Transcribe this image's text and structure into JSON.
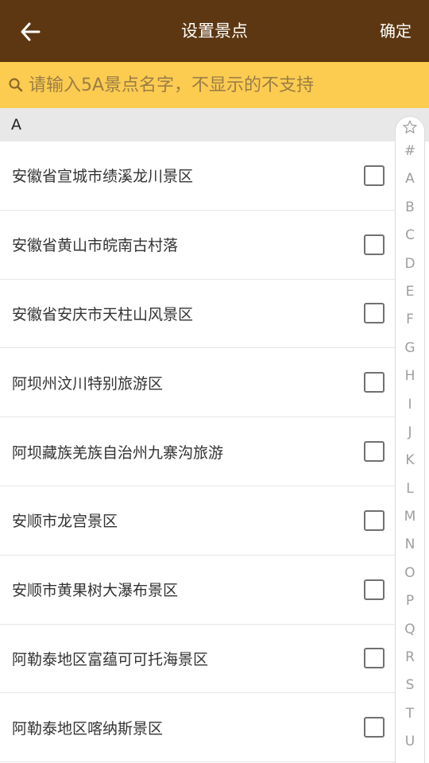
{
  "header": {
    "title": "设置景点",
    "confirm_label": "确定"
  },
  "search": {
    "placeholder": "请输入5A景点名字，不显示的不支持",
    "value": ""
  },
  "section_header": "A",
  "spots": [
    {
      "name": "安徽省宣城市绩溪龙川景区",
      "checked": false
    },
    {
      "name": "安徽省黄山市皖南古村落",
      "checked": false
    },
    {
      "name": "安徽省安庆市天柱山风景区",
      "checked": false
    },
    {
      "name": "阿坝州汶川特别旅游区",
      "checked": false
    },
    {
      "name": "阿坝藏族羌族自治州九寨沟旅游",
      "checked": false
    },
    {
      "name": "安顺市龙宫景区",
      "checked": false
    },
    {
      "name": "安顺市黄果树大瀑布景区",
      "checked": false
    },
    {
      "name": "阿勒泰地区富蕴可可托海景区",
      "checked": false
    },
    {
      "name": "阿勒泰地区喀纳斯景区",
      "checked": false
    }
  ],
  "index_bar": {
    "star_icon": "star-icon",
    "letters": [
      "#",
      "A",
      "B",
      "C",
      "D",
      "E",
      "F",
      "G",
      "H",
      "I",
      "J",
      "K",
      "L",
      "M",
      "N",
      "O",
      "P",
      "Q",
      "R",
      "S",
      "T",
      "U"
    ]
  },
  "colors": {
    "header_bg": "#5c3711",
    "search_bg": "#fccc51",
    "section_bg": "#e8e8e8"
  }
}
